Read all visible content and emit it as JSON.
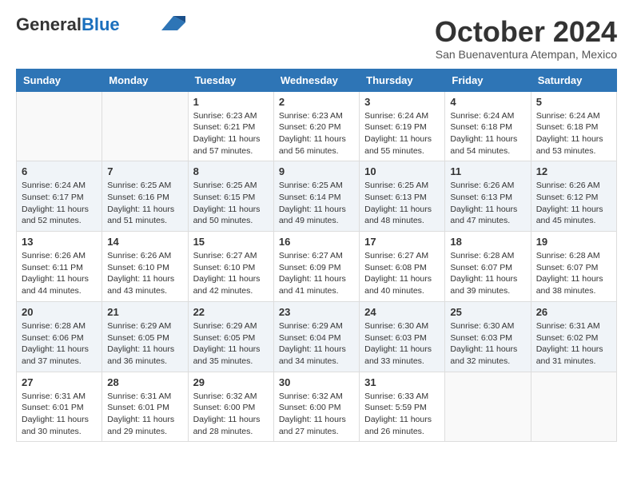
{
  "header": {
    "logo_general": "General",
    "logo_blue": "Blue",
    "month_year": "October 2024",
    "location": "San Buenaventura Atempan, Mexico"
  },
  "days_of_week": [
    "Sunday",
    "Monday",
    "Tuesday",
    "Wednesday",
    "Thursday",
    "Friday",
    "Saturday"
  ],
  "weeks": [
    [
      {
        "day": "",
        "info": ""
      },
      {
        "day": "",
        "info": ""
      },
      {
        "day": "1",
        "info": "Sunrise: 6:23 AM\nSunset: 6:21 PM\nDaylight: 11 hours and 57 minutes."
      },
      {
        "day": "2",
        "info": "Sunrise: 6:23 AM\nSunset: 6:20 PM\nDaylight: 11 hours and 56 minutes."
      },
      {
        "day": "3",
        "info": "Sunrise: 6:24 AM\nSunset: 6:19 PM\nDaylight: 11 hours and 55 minutes."
      },
      {
        "day": "4",
        "info": "Sunrise: 6:24 AM\nSunset: 6:18 PM\nDaylight: 11 hours and 54 minutes."
      },
      {
        "day": "5",
        "info": "Sunrise: 6:24 AM\nSunset: 6:18 PM\nDaylight: 11 hours and 53 minutes."
      }
    ],
    [
      {
        "day": "6",
        "info": "Sunrise: 6:24 AM\nSunset: 6:17 PM\nDaylight: 11 hours and 52 minutes."
      },
      {
        "day": "7",
        "info": "Sunrise: 6:25 AM\nSunset: 6:16 PM\nDaylight: 11 hours and 51 minutes."
      },
      {
        "day": "8",
        "info": "Sunrise: 6:25 AM\nSunset: 6:15 PM\nDaylight: 11 hours and 50 minutes."
      },
      {
        "day": "9",
        "info": "Sunrise: 6:25 AM\nSunset: 6:14 PM\nDaylight: 11 hours and 49 minutes."
      },
      {
        "day": "10",
        "info": "Sunrise: 6:25 AM\nSunset: 6:13 PM\nDaylight: 11 hours and 48 minutes."
      },
      {
        "day": "11",
        "info": "Sunrise: 6:26 AM\nSunset: 6:13 PM\nDaylight: 11 hours and 47 minutes."
      },
      {
        "day": "12",
        "info": "Sunrise: 6:26 AM\nSunset: 6:12 PM\nDaylight: 11 hours and 45 minutes."
      }
    ],
    [
      {
        "day": "13",
        "info": "Sunrise: 6:26 AM\nSunset: 6:11 PM\nDaylight: 11 hours and 44 minutes."
      },
      {
        "day": "14",
        "info": "Sunrise: 6:26 AM\nSunset: 6:10 PM\nDaylight: 11 hours and 43 minutes."
      },
      {
        "day": "15",
        "info": "Sunrise: 6:27 AM\nSunset: 6:10 PM\nDaylight: 11 hours and 42 minutes."
      },
      {
        "day": "16",
        "info": "Sunrise: 6:27 AM\nSunset: 6:09 PM\nDaylight: 11 hours and 41 minutes."
      },
      {
        "day": "17",
        "info": "Sunrise: 6:27 AM\nSunset: 6:08 PM\nDaylight: 11 hours and 40 minutes."
      },
      {
        "day": "18",
        "info": "Sunrise: 6:28 AM\nSunset: 6:07 PM\nDaylight: 11 hours and 39 minutes."
      },
      {
        "day": "19",
        "info": "Sunrise: 6:28 AM\nSunset: 6:07 PM\nDaylight: 11 hours and 38 minutes."
      }
    ],
    [
      {
        "day": "20",
        "info": "Sunrise: 6:28 AM\nSunset: 6:06 PM\nDaylight: 11 hours and 37 minutes."
      },
      {
        "day": "21",
        "info": "Sunrise: 6:29 AM\nSunset: 6:05 PM\nDaylight: 11 hours and 36 minutes."
      },
      {
        "day": "22",
        "info": "Sunrise: 6:29 AM\nSunset: 6:05 PM\nDaylight: 11 hours and 35 minutes."
      },
      {
        "day": "23",
        "info": "Sunrise: 6:29 AM\nSunset: 6:04 PM\nDaylight: 11 hours and 34 minutes."
      },
      {
        "day": "24",
        "info": "Sunrise: 6:30 AM\nSunset: 6:03 PM\nDaylight: 11 hours and 33 minutes."
      },
      {
        "day": "25",
        "info": "Sunrise: 6:30 AM\nSunset: 6:03 PM\nDaylight: 11 hours and 32 minutes."
      },
      {
        "day": "26",
        "info": "Sunrise: 6:31 AM\nSunset: 6:02 PM\nDaylight: 11 hours and 31 minutes."
      }
    ],
    [
      {
        "day": "27",
        "info": "Sunrise: 6:31 AM\nSunset: 6:01 PM\nDaylight: 11 hours and 30 minutes."
      },
      {
        "day": "28",
        "info": "Sunrise: 6:31 AM\nSunset: 6:01 PM\nDaylight: 11 hours and 29 minutes."
      },
      {
        "day": "29",
        "info": "Sunrise: 6:32 AM\nSunset: 6:00 PM\nDaylight: 11 hours and 28 minutes."
      },
      {
        "day": "30",
        "info": "Sunrise: 6:32 AM\nSunset: 6:00 PM\nDaylight: 11 hours and 27 minutes."
      },
      {
        "day": "31",
        "info": "Sunrise: 6:33 AM\nSunset: 5:59 PM\nDaylight: 11 hours and 26 minutes."
      },
      {
        "day": "",
        "info": ""
      },
      {
        "day": "",
        "info": ""
      }
    ]
  ]
}
